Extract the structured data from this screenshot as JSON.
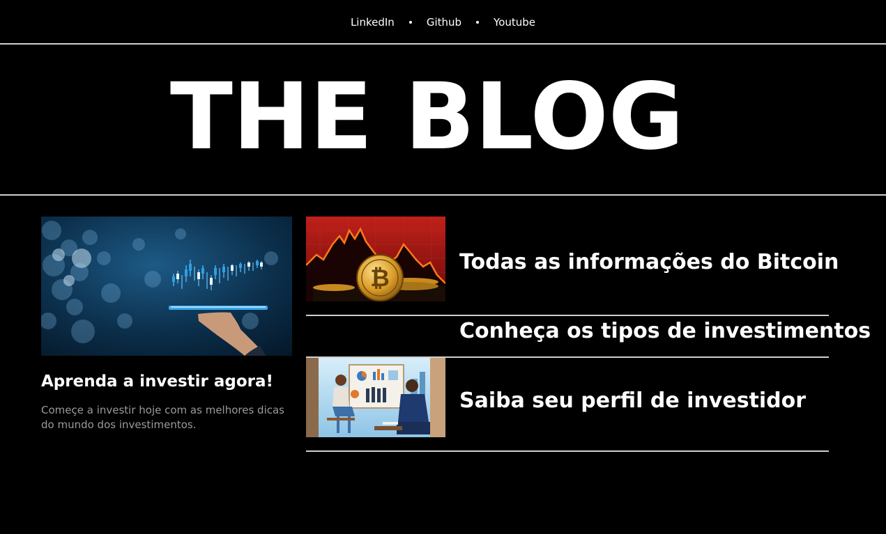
{
  "nav": {
    "links": [
      {
        "label": "LinkedIn"
      },
      {
        "label": "Github"
      },
      {
        "label": "Youtube"
      }
    ]
  },
  "hero": {
    "title": "THE BLOG"
  },
  "feature": {
    "title": "Aprenda a investir agora!",
    "description": "Começe a investir hoje com as melhores dicas do mundo dos investimentos.",
    "image_icon": "investment-chart-hand-icon"
  },
  "posts": [
    {
      "title": "Todas as informações do Bitcoin",
      "image_icon": "bitcoin-coin-icon"
    },
    {
      "title": "Conheça os tipos de investimentos"
    },
    {
      "title": "Saiba seu perfil de investidor",
      "image_icon": "advisor-meeting-icon"
    }
  ],
  "colors": {
    "background": "#000000",
    "text": "#ffffff",
    "muted": "#9a9a9a",
    "divider": "#cfcfcf"
  }
}
